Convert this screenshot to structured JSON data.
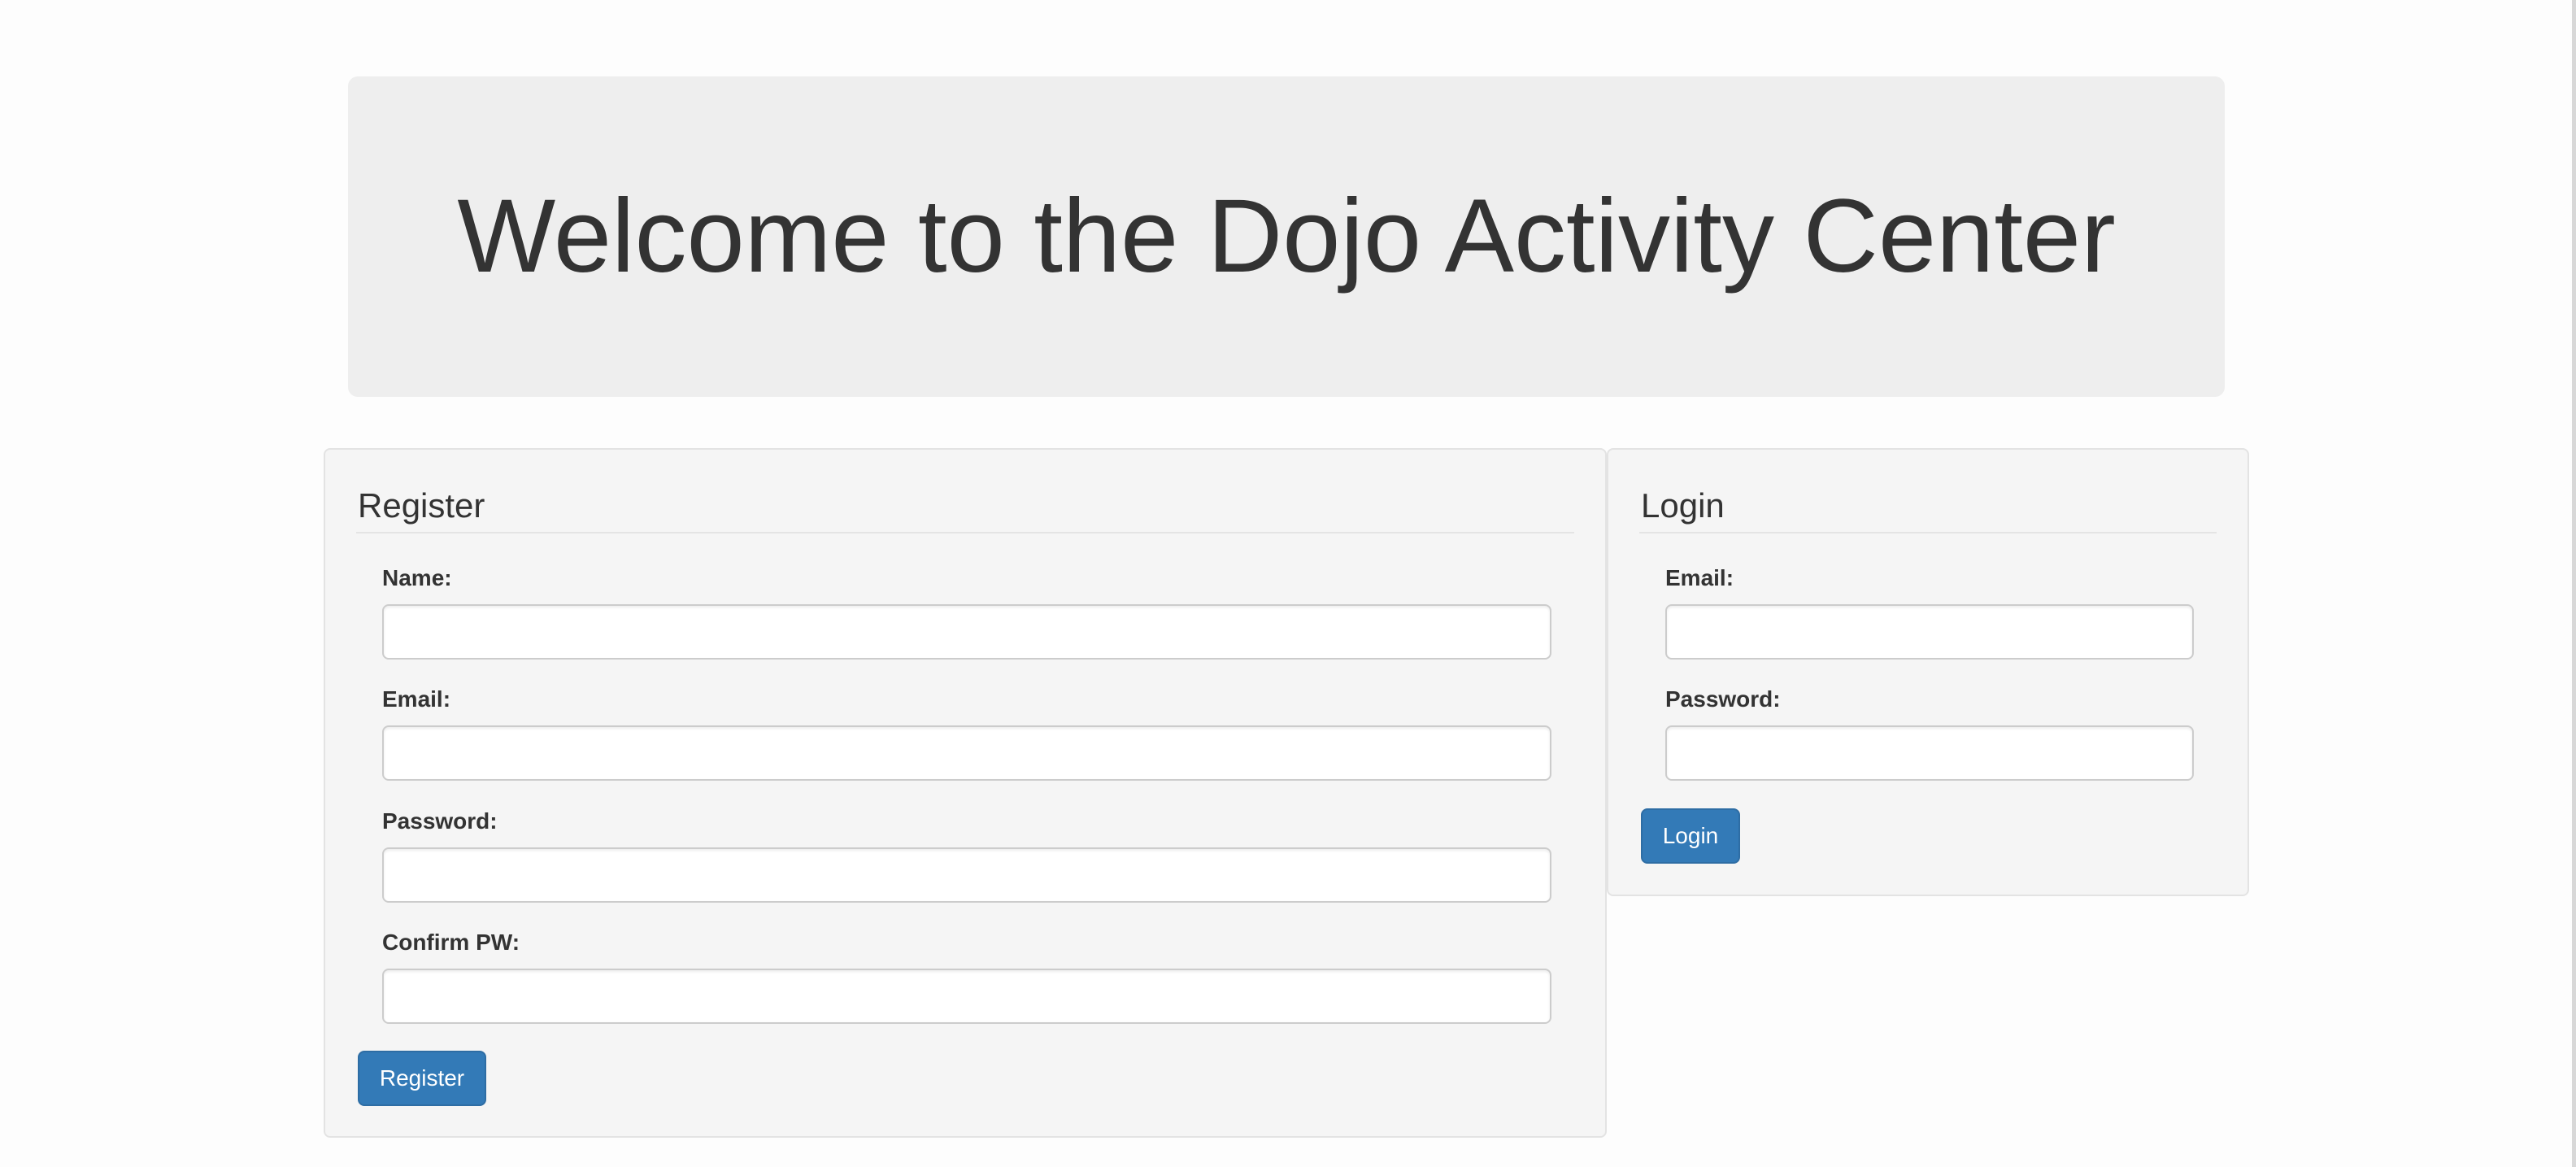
{
  "header": {
    "title": "Welcome to the Dojo Activity Center"
  },
  "register": {
    "heading": "Register",
    "fields": [
      {
        "label": "Name:",
        "value": "",
        "placeholder": ""
      },
      {
        "label": "Email:",
        "value": "",
        "placeholder": ""
      },
      {
        "label": "Password:",
        "value": "",
        "placeholder": ""
      },
      {
        "label": "Confirm PW:",
        "value": "",
        "placeholder": ""
      }
    ],
    "button_label": "Register"
  },
  "login": {
    "heading": "Login",
    "fields": [
      {
        "label": "Email:",
        "value": "",
        "placeholder": ""
      },
      {
        "label": "Password:",
        "value": "",
        "placeholder": ""
      }
    ],
    "button_label": "Login"
  },
  "colors": {
    "primary_button": "#337ab7",
    "jumbotron_bg": "#eeeeee",
    "well_bg": "#f5f5f5",
    "text": "#333333"
  }
}
